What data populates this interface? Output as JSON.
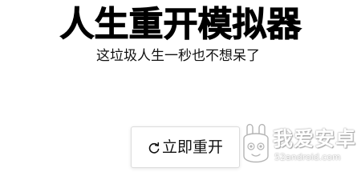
{
  "header": {
    "title": "人生重开模拟器",
    "subtitle": "这垃圾人生一秒也不想呆了"
  },
  "actions": {
    "restart_icon": "restart-icon",
    "restart_label": "立即重开"
  },
  "watermark": {
    "name": "我爱安卓",
    "url": "52android.com",
    "icon": "android-logo-icon"
  },
  "colors": {
    "background": "#ffffff",
    "text": "#111111",
    "button_border": "#dcdcdc"
  }
}
